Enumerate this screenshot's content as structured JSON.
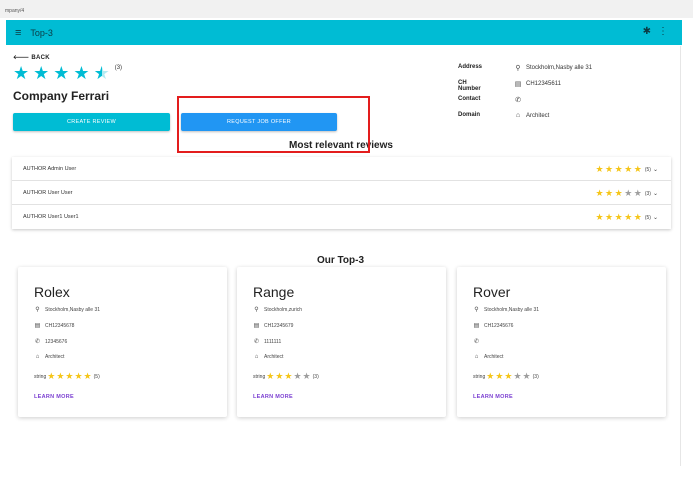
{
  "browser": {
    "url": "mpany/4"
  },
  "appbar": {
    "menu_icon": "menu-icon",
    "title": "Top-3",
    "bug_icon": "bug-icon",
    "more_icon": "more-vert-icon",
    "color": "#00bcd4"
  },
  "company": {
    "back_label": "BACK",
    "rating": 4.5,
    "rating_count": "(3)",
    "name": "Company Ferrari",
    "create_review_label": "CREATE REVIEW",
    "request_job_label": "REQUEST JOB OFFER",
    "details": [
      {
        "label": "Address",
        "icon": "location-icon",
        "value": "Stockholm,Nasby alle 31"
      },
      {
        "label": "CH Number",
        "icon": "id-card-icon",
        "value": "CH12345611"
      },
      {
        "label": "Contact",
        "icon": "phone-icon",
        "value": ""
      },
      {
        "label": "Domain",
        "icon": "bank-icon",
        "value": "Architect"
      }
    ]
  },
  "reviews": {
    "title": "Most relevant reviews",
    "items": [
      {
        "author": "AUTHOR Admin User",
        "rating": 5,
        "count": "(5)"
      },
      {
        "author": "AUTHOR User User",
        "rating": 3,
        "count": "(3)"
      },
      {
        "author": "AUTHOR User1 User1",
        "rating": 5,
        "count": "(5)"
      }
    ]
  },
  "top3": {
    "title": "Our Top-3",
    "cards": [
      {
        "name": "Rolex",
        "address": "Stockholm,Nasby alle 31",
        "ch": "CH12345678",
        "contact": "12345676",
        "domain": "Architect",
        "rating_label": "string",
        "rating": 5,
        "count": "(5)",
        "learn_more": "LEARN MORE"
      },
      {
        "name": "Range",
        "address": "Stockholm,zurich",
        "ch": "CH12345679",
        "contact": "1111111",
        "domain": "Architect",
        "rating_label": "string",
        "rating": 3,
        "count": "(3)",
        "learn_more": "LEARN MORE"
      },
      {
        "name": "Rover",
        "address": "Stockholm,Nasby alle 31",
        "ch": "CH12345676",
        "contact": "",
        "domain": "Architect",
        "rating_label": "string",
        "rating": 3,
        "count": "(3)",
        "learn_more": "LEARN MORE"
      }
    ]
  },
  "colors": {
    "accent": "#00bcd4",
    "primary_button": "#2196f3",
    "star": "#f5c518",
    "highlight": "#e31d1d",
    "link": "#7b3fd1"
  }
}
